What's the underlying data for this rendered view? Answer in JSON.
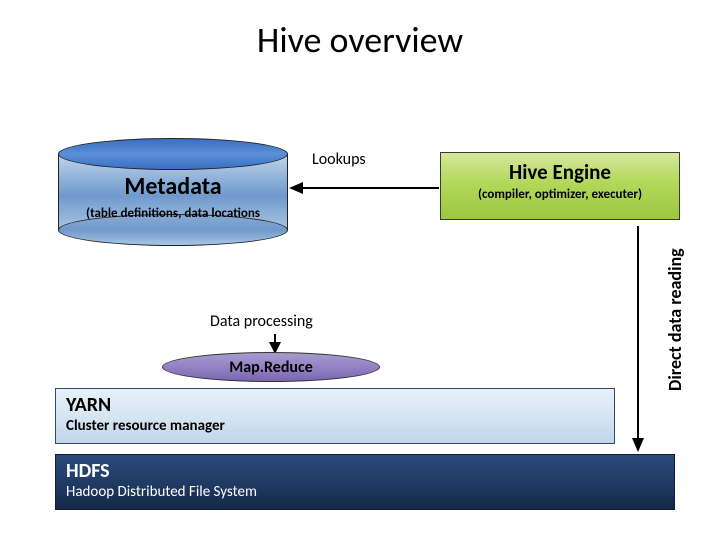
{
  "title": "Hive overview",
  "metadata": {
    "title": "Metadata",
    "subtitle": "(table definitions, data locations"
  },
  "hive_engine": {
    "title": "Hive Engine",
    "subtitle": "(compiler, optimizer, executer)"
  },
  "arrows": {
    "lookups": "Lookups",
    "data_processing": "Data processing",
    "direct_data_reading": "Direct data reading"
  },
  "mapreduce": {
    "label": "Map.Reduce"
  },
  "yarn": {
    "title": "YARN",
    "subtitle": "Cluster resource manager"
  },
  "hdfs": {
    "title": "HDFS",
    "subtitle": "Hadoop Distributed File System"
  }
}
